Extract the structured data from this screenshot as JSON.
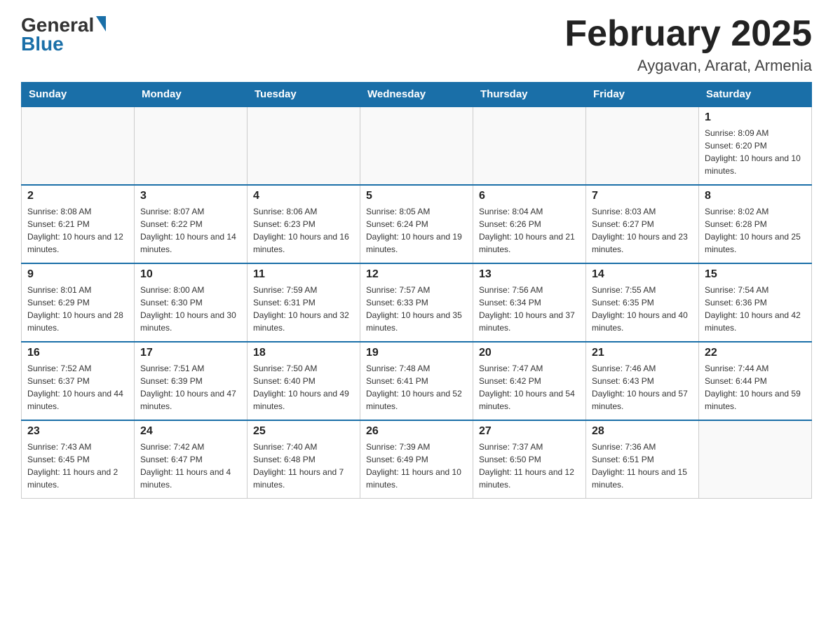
{
  "header": {
    "logo_general": "General",
    "logo_blue": "Blue",
    "month_title": "February 2025",
    "location": "Aygavan, Ararat, Armenia"
  },
  "days_of_week": [
    "Sunday",
    "Monday",
    "Tuesday",
    "Wednesday",
    "Thursday",
    "Friday",
    "Saturday"
  ],
  "weeks": [
    {
      "days": [
        {
          "number": "",
          "info": ""
        },
        {
          "number": "",
          "info": ""
        },
        {
          "number": "",
          "info": ""
        },
        {
          "number": "",
          "info": ""
        },
        {
          "number": "",
          "info": ""
        },
        {
          "number": "",
          "info": ""
        },
        {
          "number": "1",
          "info": "Sunrise: 8:09 AM\nSunset: 6:20 PM\nDaylight: 10 hours and 10 minutes."
        }
      ]
    },
    {
      "days": [
        {
          "number": "2",
          "info": "Sunrise: 8:08 AM\nSunset: 6:21 PM\nDaylight: 10 hours and 12 minutes."
        },
        {
          "number": "3",
          "info": "Sunrise: 8:07 AM\nSunset: 6:22 PM\nDaylight: 10 hours and 14 minutes."
        },
        {
          "number": "4",
          "info": "Sunrise: 8:06 AM\nSunset: 6:23 PM\nDaylight: 10 hours and 16 minutes."
        },
        {
          "number": "5",
          "info": "Sunrise: 8:05 AM\nSunset: 6:24 PM\nDaylight: 10 hours and 19 minutes."
        },
        {
          "number": "6",
          "info": "Sunrise: 8:04 AM\nSunset: 6:26 PM\nDaylight: 10 hours and 21 minutes."
        },
        {
          "number": "7",
          "info": "Sunrise: 8:03 AM\nSunset: 6:27 PM\nDaylight: 10 hours and 23 minutes."
        },
        {
          "number": "8",
          "info": "Sunrise: 8:02 AM\nSunset: 6:28 PM\nDaylight: 10 hours and 25 minutes."
        }
      ]
    },
    {
      "days": [
        {
          "number": "9",
          "info": "Sunrise: 8:01 AM\nSunset: 6:29 PM\nDaylight: 10 hours and 28 minutes."
        },
        {
          "number": "10",
          "info": "Sunrise: 8:00 AM\nSunset: 6:30 PM\nDaylight: 10 hours and 30 minutes."
        },
        {
          "number": "11",
          "info": "Sunrise: 7:59 AM\nSunset: 6:31 PM\nDaylight: 10 hours and 32 minutes."
        },
        {
          "number": "12",
          "info": "Sunrise: 7:57 AM\nSunset: 6:33 PM\nDaylight: 10 hours and 35 minutes."
        },
        {
          "number": "13",
          "info": "Sunrise: 7:56 AM\nSunset: 6:34 PM\nDaylight: 10 hours and 37 minutes."
        },
        {
          "number": "14",
          "info": "Sunrise: 7:55 AM\nSunset: 6:35 PM\nDaylight: 10 hours and 40 minutes."
        },
        {
          "number": "15",
          "info": "Sunrise: 7:54 AM\nSunset: 6:36 PM\nDaylight: 10 hours and 42 minutes."
        }
      ]
    },
    {
      "days": [
        {
          "number": "16",
          "info": "Sunrise: 7:52 AM\nSunset: 6:37 PM\nDaylight: 10 hours and 44 minutes."
        },
        {
          "number": "17",
          "info": "Sunrise: 7:51 AM\nSunset: 6:39 PM\nDaylight: 10 hours and 47 minutes."
        },
        {
          "number": "18",
          "info": "Sunrise: 7:50 AM\nSunset: 6:40 PM\nDaylight: 10 hours and 49 minutes."
        },
        {
          "number": "19",
          "info": "Sunrise: 7:48 AM\nSunset: 6:41 PM\nDaylight: 10 hours and 52 minutes."
        },
        {
          "number": "20",
          "info": "Sunrise: 7:47 AM\nSunset: 6:42 PM\nDaylight: 10 hours and 54 minutes."
        },
        {
          "number": "21",
          "info": "Sunrise: 7:46 AM\nSunset: 6:43 PM\nDaylight: 10 hours and 57 minutes."
        },
        {
          "number": "22",
          "info": "Sunrise: 7:44 AM\nSunset: 6:44 PM\nDaylight: 10 hours and 59 minutes."
        }
      ]
    },
    {
      "days": [
        {
          "number": "23",
          "info": "Sunrise: 7:43 AM\nSunset: 6:45 PM\nDaylight: 11 hours and 2 minutes."
        },
        {
          "number": "24",
          "info": "Sunrise: 7:42 AM\nSunset: 6:47 PM\nDaylight: 11 hours and 4 minutes."
        },
        {
          "number": "25",
          "info": "Sunrise: 7:40 AM\nSunset: 6:48 PM\nDaylight: 11 hours and 7 minutes."
        },
        {
          "number": "26",
          "info": "Sunrise: 7:39 AM\nSunset: 6:49 PM\nDaylight: 11 hours and 10 minutes."
        },
        {
          "number": "27",
          "info": "Sunrise: 7:37 AM\nSunset: 6:50 PM\nDaylight: 11 hours and 12 minutes."
        },
        {
          "number": "28",
          "info": "Sunrise: 7:36 AM\nSunset: 6:51 PM\nDaylight: 11 hours and 15 minutes."
        },
        {
          "number": "",
          "info": ""
        }
      ]
    }
  ]
}
